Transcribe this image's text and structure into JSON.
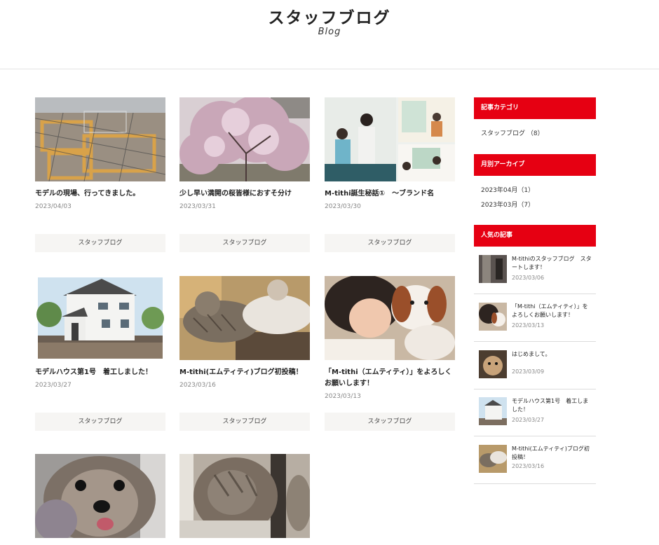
{
  "header": {
    "title": "スタッフブログ",
    "subtitle": "Blog"
  },
  "posts": [
    {
      "title": "モデルの現場、行ってきました。",
      "date": "2023/04/03",
      "category": "スタッフブログ",
      "image": "construction-photo"
    },
    {
      "title": "少し早い満開の桜皆様におすそ分け",
      "date": "2023/03/31",
      "category": "スタッフブログ",
      "image": "cherry-blossom-photo"
    },
    {
      "title": "M-tithi誕生秘話①　～ブランド名",
      "date": "2023/03/30",
      "category": "スタッフブログ",
      "image": "family-collage-photo"
    },
    {
      "title": "モデルハウス第1号　着工しました！",
      "date": "2023/03/27",
      "category": "スタッフブログ",
      "image": "model-house-photo"
    },
    {
      "title": "M-tithi(エムティティ)ブログ初投稿！",
      "date": "2023/03/16",
      "category": "スタッフブログ",
      "image": "cats-photo"
    },
    {
      "title": "「M-tithi（エムティティ）」をよろしくお願いします！",
      "date": "2023/03/13",
      "category": "スタッフブログ",
      "image": "girl-puppy-photo"
    },
    {
      "title": "",
      "date": "",
      "category": "",
      "image": "dog-photo"
    },
    {
      "title": "",
      "date": "",
      "category": "",
      "image": "kitten-photo"
    }
  ],
  "sidebar": {
    "categories": {
      "heading": "記事カテゴリ",
      "items": [
        "スタッフブログ （8）"
      ]
    },
    "archive": {
      "heading": "月別アーカイブ",
      "items": [
        "2023年04月（1）",
        "2023年03月（7）"
      ]
    },
    "popular": {
      "heading": "人気の記事",
      "items": [
        {
          "title": "M-tithiのスタッフブログ　スタートします！",
          "date": "2023/03/06"
        },
        {
          "title": "「M-tithi（エムティティ）」をよろしくお願いします！",
          "date": "2023/03/13"
        },
        {
          "title": "はじめまして。",
          "date": "2023/03/09"
        },
        {
          "title": "モデルハウス第1号　着工しました！",
          "date": "2023/03/27"
        },
        {
          "title": "M-tithi(エムティティ)ブログ初投稿！",
          "date": "2023/03/16"
        }
      ]
    }
  },
  "colors": {
    "accent": "#e60012",
    "category_bg": "#f6f5f3",
    "divider": "#dcdcdc"
  }
}
